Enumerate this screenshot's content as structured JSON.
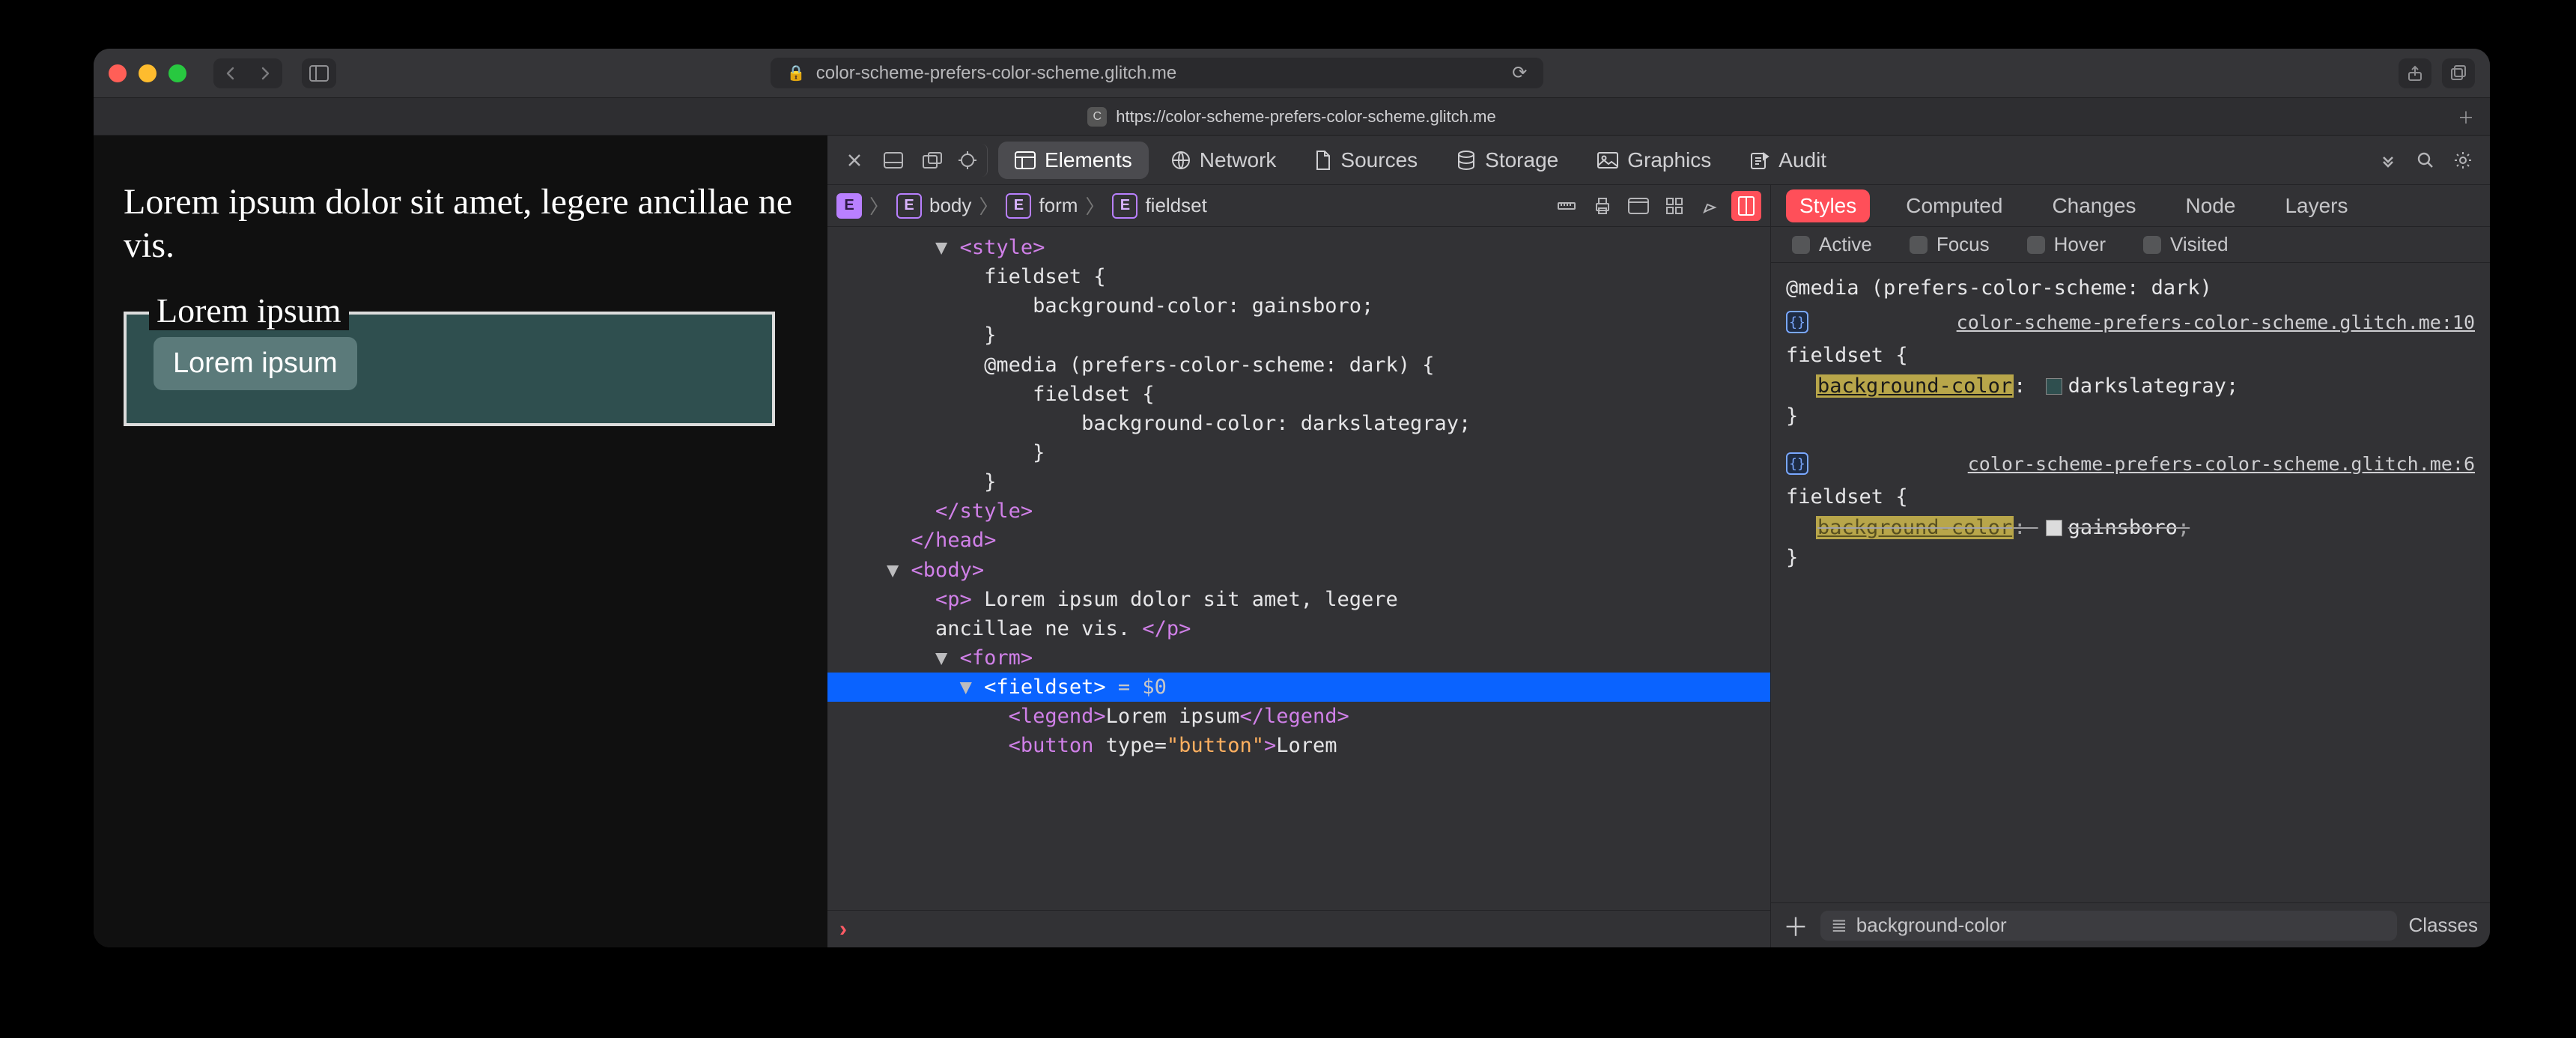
{
  "toolbar": {
    "url_host": "color-scheme-prefers-color-scheme.glitch.me",
    "reload_icon": "reload"
  },
  "tab": {
    "title": "https://color-scheme-prefers-color-scheme.glitch.me",
    "favicon_letter": "C"
  },
  "page": {
    "paragraph": "Lorem ipsum dolor sit amet, legere ancillae ne vis.",
    "legend": "Lorem ipsum",
    "button": "Lorem ipsum"
  },
  "devtools": {
    "tabs": [
      "Elements",
      "Network",
      "Sources",
      "Storage",
      "Graphics",
      "Audit"
    ],
    "active_tab": "Elements",
    "breadcrumb": [
      "body",
      "form",
      "fieldset"
    ],
    "crumb_tools": [
      "ruler-icon",
      "print-icon",
      "device-icon",
      "grid-icon",
      "paint-icon",
      "layout-icon"
    ],
    "tree_lines": [
      {
        "indent": 4,
        "pre": "▼ ",
        "open": "<style>",
        "text": ""
      },
      {
        "indent": 6,
        "text": "fieldset {"
      },
      {
        "indent": 8,
        "text": "background-color: gainsboro;"
      },
      {
        "indent": 6,
        "text": "}"
      },
      {
        "indent": 6,
        "text": "@media (prefers-color-scheme: dark) {"
      },
      {
        "indent": 8,
        "text": "fieldset {"
      },
      {
        "indent": 10,
        "text": "background-color: darkslategray;"
      },
      {
        "indent": 8,
        "text": "}"
      },
      {
        "indent": 6,
        "text": "}"
      },
      {
        "indent": 4,
        "close": "</style>"
      },
      {
        "indent": 3,
        "close": "</head>"
      },
      {
        "indent": 2,
        "pre": "▼ ",
        "open": "<body>"
      },
      {
        "indent": 4,
        "open": "<p>",
        "text": " Lorem ipsum dolor sit amet, legere",
        "wrap": true
      },
      {
        "indent": 4,
        "cont": "ancillae ne vis. ",
        "close": "</p>"
      },
      {
        "indent": 4,
        "pre": "▼ ",
        "open": "<form>"
      },
      {
        "indent": 5,
        "selected": true,
        "pre": "▼ ",
        "open": "<fieldset>",
        "eq0": " = $0"
      },
      {
        "indent": 7,
        "open": "<legend>",
        "text": "Lorem ipsum",
        "close": "</legend>"
      },
      {
        "indent": 7,
        "open_attr": {
          "tag": "button",
          "attrs": [
            [
              "type",
              "\"button\""
            ]
          ]
        },
        "text": "Lorem"
      }
    ],
    "styles": {
      "tabs": [
        "Styles",
        "Computed",
        "Changes",
        "Node",
        "Layers"
      ],
      "active_tab": "Styles",
      "pseudo": [
        "Active",
        "Focus",
        "Hover",
        "Visited"
      ],
      "rules": [
        {
          "media": "@media (prefers-color-scheme: dark)",
          "source": "color-scheme-prefers-color-scheme.glitch.me:10",
          "selector": "fieldset",
          "decls": [
            {
              "prop": "background-color",
              "val": "darkslategray",
              "swatch": "#2f4f4f"
            }
          ],
          "strike": false
        },
        {
          "source": "color-scheme-prefers-color-scheme.glitch.me:6",
          "selector": "fieldset",
          "decls": [
            {
              "prop": "background-color",
              "val": "gainsboro",
              "swatch": "#dcdcdc"
            }
          ],
          "strike": true
        }
      ],
      "filter_text": "background-color",
      "classes_label": "Classes"
    }
  }
}
